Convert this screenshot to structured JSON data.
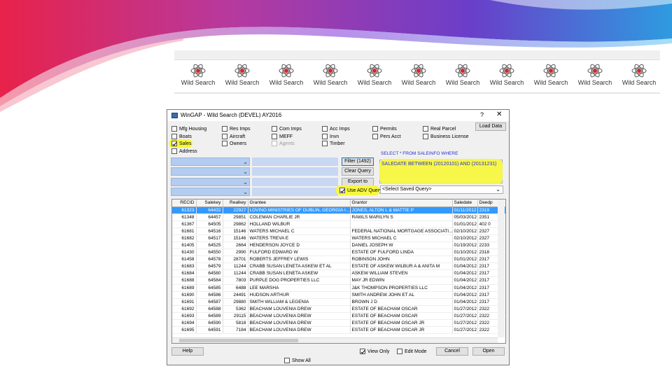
{
  "toolbar": {
    "button_label": "Wild Search",
    "buttons": [
      "Wild Search",
      "Wild Search",
      "Wild Search",
      "Wild Search",
      "Wild Search",
      "Wild Search",
      "Wild Search",
      "Wild Search",
      "Wild Search",
      "Wild Search",
      "Wild Search"
    ]
  },
  "window": {
    "title": "WinGAP - Wild Search (DEVEL) AY2016",
    "help_glyph": "?",
    "close_glyph": "✕"
  },
  "checkboxes": {
    "mfg_housing": "Mfg Housing",
    "boats": "Boats",
    "sales": "Sales",
    "address": "Address",
    "res_imps": "Res Imps",
    "aircraft": "Aircraft",
    "owners": "Owners",
    "com_imps": "Com Imps",
    "meff": "MEFF",
    "agents": "Agents",
    "acc_imps": "Acc Imps",
    "invn": "Invn",
    "timber": "Timber",
    "permits": "Permits",
    "pers_acct": "Pers Acct",
    "real_parcel": "Real Parcel",
    "business_license": "Business License"
  },
  "buttons": {
    "load_data": "Load Data",
    "filter": "Filter (1492)",
    "clear_query": "Clear Query",
    "export_excel": "Export to Excel",
    "use_adv_query": "Use ADV Query",
    "help": "Help",
    "cancel": "Cancel",
    "open": "Open"
  },
  "query": {
    "select_label": "SELECT * FROM SALEINFO WHERE",
    "sql": "SALEDATE BETWEEN (20120101) AND (20131231)",
    "saved_query_placeholder": "<Select Saved Query>"
  },
  "footer": {
    "view_only": "View Only",
    "edit_mode": "Edit Mode",
    "show_all": "Show All"
  },
  "grid": {
    "columns": [
      "RECID",
      "Salekey",
      "Realkey",
      "Grantee",
      "Grantor",
      "Saledate",
      "Deedp"
    ],
    "rows": [
      [
        "61323",
        "64432",
        "22927",
        "LOVING MINISTRIES OF DUBLIN, GEORGIA I...",
        "JONES, ALTON L & MATTIE P",
        "01/11/2012",
        "2319"
      ],
      [
        "61348",
        "64457",
        "29851",
        "COLEMAN CHARLIE JR",
        "RAWLS MARILYN S",
        "05/03/2012",
        "2351"
      ],
      [
        "61367",
        "64505",
        "29862",
        "HOLLAND WILBUR",
        "",
        "01/01/2012",
        "402 0"
      ],
      [
        "61681",
        "64516",
        "15146",
        "WATERS MICHAEL C",
        "FEDERAL NATIONAL MORTGAGE ASSOCIATI...",
        "02/10/2012",
        "2327"
      ],
      [
        "61682",
        "64517",
        "15146",
        "WATERS TREVA E",
        "WATERS MICHAEL C",
        "02/10/2012",
        "2327"
      ],
      [
        "61405",
        "64525",
        "2664",
        "HENDERSON JOYCE D",
        "DANIEL JOSEPH W",
        "01/19/2012",
        "2233"
      ],
      [
        "61430",
        "64550",
        "2990",
        "FULFORD EDWARD W",
        "ESTATE OF FULFORD LINDA",
        "01/10/2012",
        "2318"
      ],
      [
        "61458",
        "64578",
        "28701",
        "ROBERTS JEFFREY LEWIS",
        "ROBINSON JOHN",
        "01/01/2012",
        "2317"
      ],
      [
        "61683",
        "64579",
        "11244",
        "CRABB SUSAN LENETA ASKEW ET AL",
        "ESTATE OF ASKEW WILBUR A & ANITA M",
        "01/04/2012",
        "2317"
      ],
      [
        "61684",
        "64580",
        "11244",
        "CRABB SUSAN LENETA ASKEW",
        "ASKEW WILLIAM STEVEN",
        "01/04/2012",
        "2317"
      ],
      [
        "61688",
        "64584",
        "7803",
        "PURPLE DOG PROPERTIES LLC",
        "MAY JR EDWIN",
        "01/04/2012",
        "2317"
      ],
      [
        "61689",
        "64585",
        "6488",
        "LEE MARSHA",
        "J&K THOMPSON PROPERTIES LLC",
        "01/04/2012",
        "2317"
      ],
      [
        "61690",
        "64586",
        "24491",
        "HUDSON ARTHUR",
        "SMITH ANDREW JOHN ET AL",
        "01/04/2012",
        "2317"
      ],
      [
        "61691",
        "64587",
        "29880",
        "SMITH WILLIAM & LEGENIA",
        "BROWN J D",
        "01/04/2012",
        "2317"
      ],
      [
        "61692",
        "64588",
        "5362",
        "BEACHAM LOUVENIA DREW",
        "ESTATE OF BEACHAM OSCAR",
        "01/27/2012",
        "2322"
      ],
      [
        "61693",
        "64589",
        "29115",
        "BEACHAM LOUVENIA DREW",
        "ESTATE OF BEACHAM OSCAR",
        "01/27/2012",
        "2322"
      ],
      [
        "61694",
        "64590",
        "5818",
        "BEACHAM LOUVENIA DREW",
        "ESTATE OF BEACHAM OSCAR JR",
        "01/27/2012",
        "2322"
      ],
      [
        "61695",
        "64591",
        "7184",
        "BEACHAM LOUVENIA DREW",
        "ESTATE OF BEACHAM OSCAR JR",
        "01/27/2012",
        "2322"
      ]
    ],
    "selected_row": 0
  },
  "colors": {
    "highlight": "#f7f740",
    "selection": "#3399ff",
    "combo": "#b3ccf0"
  }
}
